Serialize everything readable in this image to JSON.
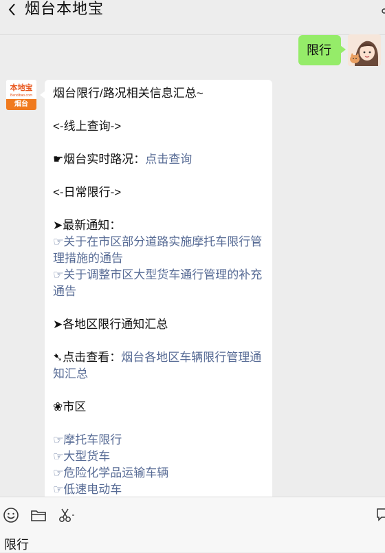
{
  "header": {
    "back_icon": "chevron-left-icon",
    "title": "烟台本地宝",
    "more_icon": "person-icon"
  },
  "outgoing": {
    "text": "限行",
    "bubble_color": "#95ec69"
  },
  "incoming": {
    "avatar": {
      "logo_text": "本地宝",
      "logo_sub": "Bendibao.com",
      "city": "烟台",
      "brand_color": "#f07a1e"
    },
    "title_line": "烟台限行/路况相关信息汇总~",
    "section_online": "<-线上查询->",
    "realtime_prefix": "☛烟台实时路况：",
    "realtime_link": "点击查询",
    "section_daily": "<-日常限行->",
    "latest_heading": "➤最新通知：",
    "notice_1": "☞关于在市区部分道路实施摩托车限行管理措施的通告",
    "notice_2": "☞关于调整市区大型货车通行管理的补充通告",
    "regions_heading": "➤各地区限行通知汇总",
    "view_prefix": "➷点击查看：",
    "view_link": "烟台各地区车辆限行管理通知汇总",
    "city_heading": "❀市区",
    "items": [
      "☞摩托车限行",
      "☞大型货车",
      "☞危险化学品运输车辆",
      "☞低速电动车"
    ],
    "link_color": "#576b95"
  },
  "toolbar": {
    "emoji_icon": "emoji-icon",
    "folder_icon": "folder-icon",
    "scissors_icon": "scissors-icon",
    "chat_icon": "chat-icon",
    "input_value": "限行"
  }
}
